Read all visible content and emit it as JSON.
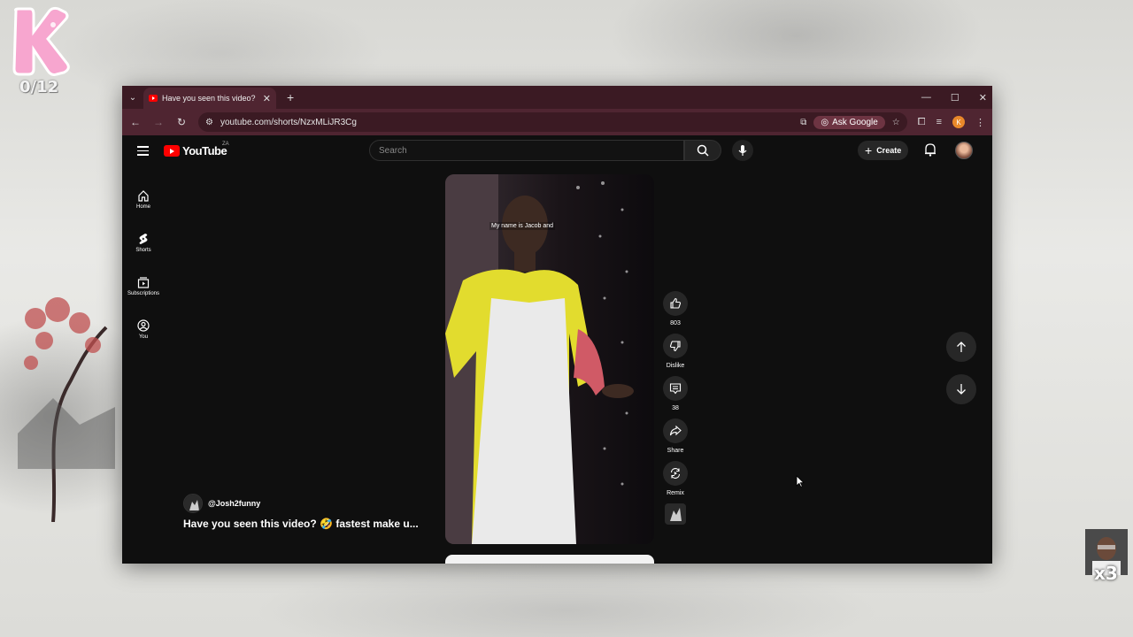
{
  "desktop": {
    "counter": "0/12",
    "webcam_overlay": "x3"
  },
  "browser": {
    "tab": {
      "title": "Have you seen this video? 🤞🔊"
    },
    "address": {
      "url": "youtube.com/shorts/NzxMLiJR3Cg"
    },
    "ask_google_label": "Ask Google",
    "profile_initial": "K"
  },
  "youtube": {
    "logo_text": "YouTube",
    "region": "ZA",
    "search_placeholder": "Search",
    "create_label": "Create",
    "sidebar": {
      "items": [
        {
          "label": "Home"
        },
        {
          "label": "Shorts"
        },
        {
          "label": "Subscriptions"
        },
        {
          "label": "You"
        }
      ]
    },
    "short": {
      "caption": "My name is Jacob and",
      "channel": "@Josh2funny",
      "title": "Have you seen this video? 🤣 fastest make u...",
      "actions": {
        "likes": "803",
        "dislike": "Dislike",
        "comments": "38",
        "share": "Share",
        "remix": "Remix"
      }
    }
  }
}
